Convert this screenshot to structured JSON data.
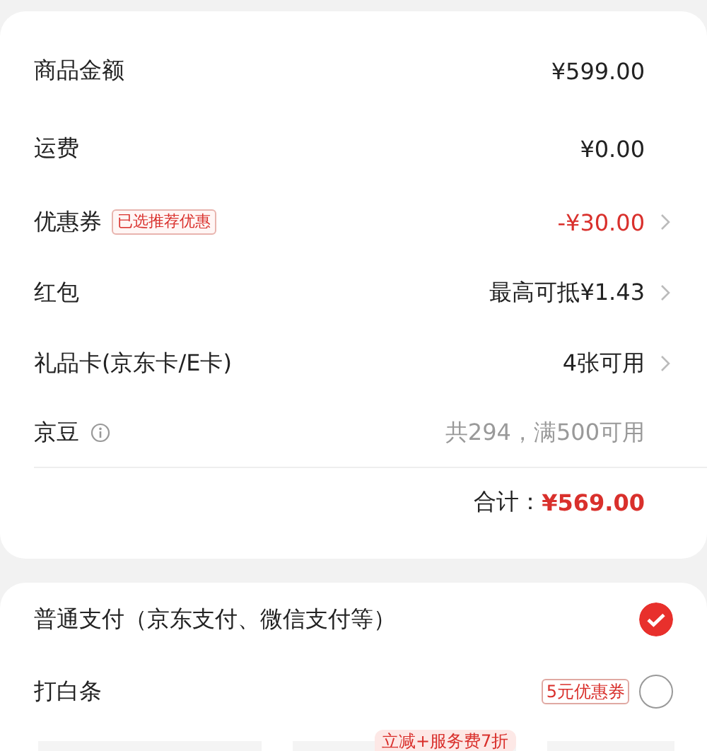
{
  "fees": [
    {
      "label": "商品金额",
      "value": "¥599.00",
      "kind": "amount",
      "arrow": false
    },
    {
      "label": "运费",
      "value": "¥0.00",
      "kind": "amount",
      "arrow": false
    },
    {
      "label": "优惠券",
      "tag": "已选推荐优惠",
      "value": "-¥30.00",
      "kind": "discount",
      "arrow": true
    },
    {
      "label": "红包",
      "value": "最高可抵¥1.43",
      "kind": "amount",
      "arrow": true
    },
    {
      "label": "礼品卡(京东卡/E卡)",
      "value": "4张可用",
      "kind": "amount",
      "arrow": true
    },
    {
      "label": "京豆",
      "info": true,
      "value": "共294，满500可用",
      "kind": "hint",
      "arrow": false
    }
  ],
  "total": {
    "label": "合计：",
    "value": "¥569.00"
  },
  "payments": [
    {
      "label": "普通支付（京东支付、微信支付等）",
      "selected": true
    },
    {
      "label": "打白条",
      "tag": "5元优惠券",
      "selected": false
    }
  ],
  "promo_badge": "立减+服务费7折"
}
